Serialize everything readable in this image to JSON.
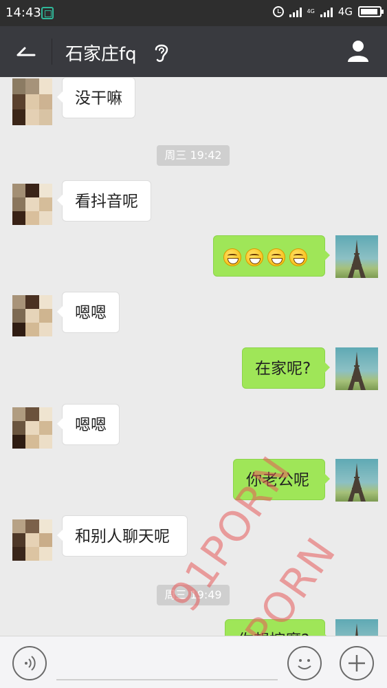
{
  "status_bar": {
    "time": "14:43",
    "network": "4G",
    "mini_network_tag": "4G"
  },
  "header": {
    "title": "石家庄fq"
  },
  "messages": [
    {
      "side": "left",
      "text": "没干嘛"
    },
    {
      "side": "time",
      "text": "周三 19:42"
    },
    {
      "side": "left",
      "text": "看抖音呢"
    },
    {
      "side": "right",
      "emoji_count": 4
    },
    {
      "side": "left",
      "text": "嗯嗯"
    },
    {
      "side": "right",
      "text": "在家呢?"
    },
    {
      "side": "left",
      "text": "嗯嗯"
    },
    {
      "side": "right",
      "text": "你老公呢"
    },
    {
      "side": "left",
      "text": "和别人聊天呢"
    },
    {
      "side": "time",
      "text": "周三 19:49"
    },
    {
      "side": "right",
      "text": "你想控魔?"
    }
  ],
  "watermarks": [
    "91PORN",
    "91PORN"
  ],
  "icons": {
    "back": "back-arrow-icon",
    "ear": "ear-icon",
    "profile": "person-icon",
    "voice": "voice-icon",
    "emoji": "emoji-face-icon",
    "plus": "plus-icon"
  },
  "colors": {
    "header_bg": "#393a3f",
    "status_bg": "#2e2e2e",
    "chat_bg": "#ebebeb",
    "bubble_right": "#9fe658",
    "bubble_left": "#ffffff",
    "watermark": "#e65a5a"
  }
}
